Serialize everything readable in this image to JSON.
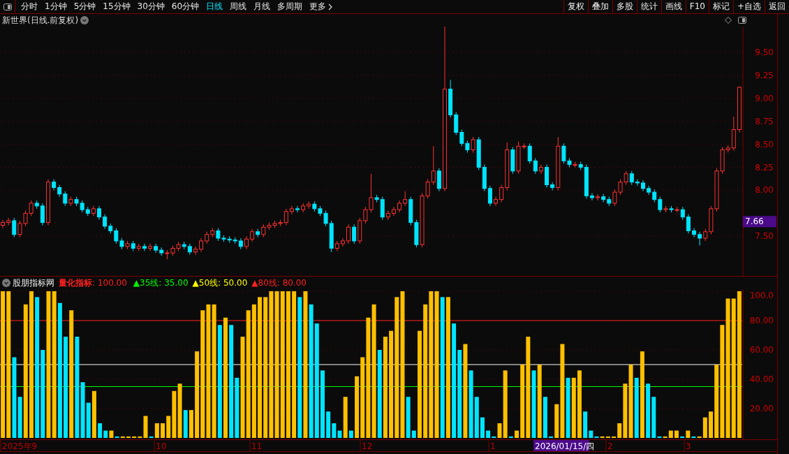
{
  "toolbar": {
    "tabs": [
      {
        "label": "分时",
        "selected": false
      },
      {
        "label": "1分钟",
        "selected": false
      },
      {
        "label": "5分钟",
        "selected": false
      },
      {
        "label": "15分钟",
        "selected": false
      },
      {
        "label": "30分钟",
        "selected": false
      },
      {
        "label": "60分钟",
        "selected": false
      },
      {
        "label": "日线",
        "selected": true
      },
      {
        "label": "周线",
        "selected": false
      },
      {
        "label": "月线",
        "selected": false
      },
      {
        "label": "多周期",
        "selected": false
      },
      {
        "label": "更多",
        "selected": false
      }
    ],
    "buttons": [
      "复权",
      "叠加",
      "多股",
      "统计",
      "画线",
      "F10",
      "标记",
      "+自选",
      "返回"
    ]
  },
  "price_panel": {
    "title": "新世界(日线.前复权)",
    "current_price": "7.66",
    "chart_data": {
      "type": "candlestick",
      "grid": true,
      "ylim": [
        7.07,
        9.78
      ],
      "yticks": [
        {
          "value": 7.5,
          "label": "7.50"
        },
        {
          "value": 8,
          "label": "8.00"
        },
        {
          "value": 8.25,
          "label": "8.25"
        },
        {
          "value": 8.5,
          "label": "8.50"
        },
        {
          "value": 8.75,
          "label": "8.75"
        },
        {
          "value": 9,
          "label": "9.00"
        },
        {
          "value": 9.25,
          "label": "9.25"
        },
        {
          "value": 9.5,
          "label": "9.50"
        }
      ],
      "ohlc": [
        [
          7.62,
          7.68,
          7.59,
          7.65
        ],
        [
          7.65,
          7.7,
          7.62,
          7.67
        ],
        [
          7.67,
          7.7,
          7.49,
          7.52
        ],
        [
          7.52,
          7.67,
          7.49,
          7.64
        ],
        [
          7.64,
          7.78,
          7.61,
          7.75
        ],
        [
          7.75,
          7.89,
          7.72,
          7.86
        ],
        [
          7.86,
          7.89,
          7.8,
          7.83
        ],
        [
          7.83,
          7.86,
          7.62,
          7.65
        ],
        [
          7.65,
          8.12,
          7.62,
          8.09
        ],
        [
          8.09,
          8.12,
          8.0,
          8.03
        ],
        [
          8.03,
          8.06,
          7.93,
          7.96
        ],
        [
          7.96,
          7.99,
          7.83,
          7.86
        ],
        [
          7.86,
          7.93,
          7.83,
          7.9
        ],
        [
          7.9,
          7.93,
          7.83,
          7.86
        ],
        [
          7.86,
          7.89,
          7.76,
          7.79
        ],
        [
          7.79,
          7.82,
          7.72,
          7.75
        ],
        [
          7.75,
          7.83,
          7.72,
          7.8
        ],
        [
          7.8,
          7.83,
          7.68,
          7.71
        ],
        [
          7.71,
          7.74,
          7.58,
          7.61
        ],
        [
          7.61,
          7.64,
          7.53,
          7.56
        ],
        [
          7.56,
          7.59,
          7.42,
          7.45
        ],
        [
          7.45,
          7.48,
          7.36,
          7.39
        ],
        [
          7.39,
          7.45,
          7.36,
          7.42
        ],
        [
          7.42,
          7.45,
          7.34,
          7.37
        ],
        [
          7.37,
          7.42,
          7.34,
          7.39
        ],
        [
          7.39,
          7.42,
          7.34,
          7.37
        ],
        [
          7.37,
          7.42,
          7.34,
          7.39
        ],
        [
          7.39,
          7.42,
          7.32,
          7.35
        ],
        [
          7.35,
          7.38,
          7.29,
          7.32
        ],
        [
          7.32,
          7.35,
          7.25,
          7.32
        ],
        [
          7.32,
          7.4,
          7.29,
          7.37
        ],
        [
          7.37,
          7.44,
          7.34,
          7.41
        ],
        [
          7.41,
          7.44,
          7.36,
          7.39
        ],
        [
          7.39,
          7.42,
          7.3,
          7.33
        ],
        [
          7.33,
          7.39,
          7.3,
          7.36
        ],
        [
          7.36,
          7.48,
          7.33,
          7.45
        ],
        [
          7.45,
          7.55,
          7.42,
          7.52
        ],
        [
          7.52,
          7.59,
          7.49,
          7.56
        ],
        [
          7.56,
          7.59,
          7.45,
          7.48
        ],
        [
          7.48,
          7.51,
          7.44,
          7.47
        ],
        [
          7.47,
          7.5,
          7.43,
          7.46
        ],
        [
          7.46,
          7.49,
          7.42,
          7.45
        ],
        [
          7.45,
          7.48,
          7.36,
          7.39
        ],
        [
          7.39,
          7.5,
          7.36,
          7.47
        ],
        [
          7.47,
          7.58,
          7.44,
          7.55
        ],
        [
          7.55,
          7.58,
          7.49,
          7.52
        ],
        [
          7.52,
          7.63,
          7.49,
          7.6
        ],
        [
          7.6,
          7.65,
          7.57,
          7.62
        ],
        [
          7.62,
          7.67,
          7.59,
          7.64
        ],
        [
          7.64,
          7.68,
          7.61,
          7.65
        ],
        [
          7.65,
          7.8,
          7.62,
          7.77
        ],
        [
          7.77,
          7.83,
          7.74,
          7.8
        ],
        [
          7.8,
          7.83,
          7.76,
          7.79
        ],
        [
          7.79,
          7.86,
          7.76,
          7.83
        ],
        [
          7.83,
          7.88,
          7.8,
          7.85
        ],
        [
          7.85,
          7.88,
          7.77,
          7.8
        ],
        [
          7.8,
          7.83,
          7.72,
          7.75
        ],
        [
          7.75,
          7.78,
          7.61,
          7.64
        ],
        [
          7.64,
          7.67,
          7.33,
          7.37
        ],
        [
          7.37,
          7.45,
          7.34,
          7.42
        ],
        [
          7.42,
          7.48,
          7.39,
          7.45
        ],
        [
          7.45,
          7.63,
          7.42,
          7.6
        ],
        [
          7.6,
          7.63,
          7.42,
          7.45
        ],
        [
          7.45,
          7.7,
          7.42,
          7.67
        ],
        [
          7.67,
          7.82,
          7.64,
          7.79
        ],
        [
          7.79,
          8.18,
          7.76,
          7.92
        ],
        [
          7.92,
          7.95,
          7.87,
          7.9
        ],
        [
          7.9,
          7.93,
          7.68,
          7.71
        ],
        [
          7.71,
          7.78,
          7.68,
          7.75
        ],
        [
          7.75,
          7.82,
          7.72,
          7.79
        ],
        [
          7.79,
          7.89,
          7.76,
          7.86
        ],
        [
          7.86,
          7.99,
          7.83,
          7.9
        ],
        [
          7.9,
          7.93,
          7.62,
          7.65
        ],
        [
          7.65,
          7.68,
          7.38,
          7.41
        ],
        [
          7.41,
          7.97,
          7.38,
          7.94
        ],
        [
          7.94,
          8.12,
          7.91,
          8.09
        ],
        [
          8.09,
          8.48,
          8.06,
          8.21
        ],
        [
          8.21,
          8.24,
          7.99,
          8.02
        ],
        [
          8.02,
          9.78,
          7.99,
          9.1
        ],
        [
          9.1,
          9.2,
          8.79,
          8.82
        ],
        [
          8.82,
          8.85,
          8.6,
          8.63
        ],
        [
          8.63,
          8.66,
          8.48,
          8.51
        ],
        [
          8.51,
          8.54,
          8.41,
          8.44
        ],
        [
          8.44,
          8.58,
          8.41,
          8.55
        ],
        [
          8.55,
          8.58,
          8.22,
          8.25
        ],
        [
          8.25,
          8.28,
          7.99,
          8.02
        ],
        [
          8.02,
          8.05,
          7.83,
          7.86
        ],
        [
          7.86,
          7.93,
          7.83,
          7.9
        ],
        [
          7.9,
          8.06,
          7.87,
          8.03
        ],
        [
          8.03,
          8.52,
          8.0,
          8.44
        ],
        [
          8.44,
          8.47,
          8.18,
          8.21
        ],
        [
          8.21,
          8.53,
          8.18,
          8.48
        ],
        [
          8.48,
          8.51,
          8.45,
          8.48
        ],
        [
          8.48,
          8.51,
          8.29,
          8.32
        ],
        [
          8.32,
          8.35,
          8.18,
          8.21
        ],
        [
          8.21,
          8.28,
          8.18,
          8.25
        ],
        [
          8.25,
          8.28,
          8.03,
          8.06
        ],
        [
          8.06,
          8.09,
          8.0,
          8.03
        ],
        [
          8.03,
          8.58,
          8.0,
          8.48
        ],
        [
          8.48,
          8.51,
          8.29,
          8.32
        ],
        [
          8.32,
          8.35,
          8.25,
          8.28
        ],
        [
          8.28,
          8.31,
          8.25,
          8.28
        ],
        [
          8.28,
          8.31,
          8.22,
          8.25
        ],
        [
          8.25,
          8.28,
          7.91,
          7.94
        ],
        [
          7.94,
          7.97,
          7.89,
          7.92
        ],
        [
          7.92,
          7.96,
          7.89,
          7.93
        ],
        [
          7.93,
          7.96,
          7.87,
          7.9
        ],
        [
          7.9,
          7.93,
          7.83,
          7.86
        ],
        [
          7.86,
          8.01,
          7.83,
          7.98
        ],
        [
          7.98,
          8.12,
          7.95,
          8.09
        ],
        [
          8.09,
          8.21,
          8.06,
          8.18
        ],
        [
          8.18,
          8.21,
          8.06,
          8.09
        ],
        [
          8.09,
          8.12,
          8.05,
          8.08
        ],
        [
          8.08,
          8.11,
          7.99,
          8.02
        ],
        [
          8.02,
          8.05,
          7.95,
          7.98
        ],
        [
          7.98,
          8.01,
          7.87,
          7.9
        ],
        [
          7.9,
          7.93,
          7.76,
          7.79
        ],
        [
          7.79,
          7.83,
          7.76,
          7.8
        ],
        [
          7.8,
          7.83,
          7.76,
          7.79
        ],
        [
          7.79,
          7.82,
          7.76,
          7.79
        ],
        [
          7.79,
          7.82,
          7.68,
          7.71
        ],
        [
          7.71,
          7.74,
          7.53,
          7.56
        ],
        [
          7.56,
          7.59,
          7.49,
          7.52
        ],
        [
          7.52,
          7.55,
          7.4,
          7.48
        ],
        [
          7.48,
          7.58,
          7.45,
          7.55
        ],
        [
          7.55,
          7.83,
          7.52,
          7.8
        ],
        [
          7.8,
          8.24,
          7.77,
          8.21
        ],
        [
          8.21,
          8.47,
          8.18,
          8.44
        ],
        [
          8.44,
          8.49,
          8.41,
          8.46
        ],
        [
          8.46,
          8.8,
          8.43,
          8.66
        ],
        [
          8.66,
          9.13,
          8.63,
          9.12
        ]
      ]
    }
  },
  "indicator_panel": {
    "source": "股朋指标网",
    "reading": ": 100.00",
    "chart_data": {
      "type": "bar",
      "grid": true,
      "ylim": [
        0,
        101.4
      ],
      "yticks": [
        {
          "value": 20,
          "label": "20.00"
        },
        {
          "value": 40,
          "label": "40.00"
        },
        {
          "value": 60,
          "label": "60.00"
        },
        {
          "value": 80,
          "label": "80.00"
        },
        {
          "value": 100,
          "label": "100.0"
        }
      ],
      "series": [
        {
          "name": "量化指标",
          "color": "#ffc000",
          "values": [
            100,
            100,
            null,
            null,
            91,
            100,
            null,
            null,
            100,
            100,
            null,
            null,
            87,
            null,
            null,
            null,
            32,
            null,
            null,
            5,
            null,
            1,
            1,
            1,
            1,
            15,
            null,
            10,
            10,
            15,
            32,
            37,
            null,
            19,
            59,
            87,
            91,
            91,
            null,
            82,
            null,
            null,
            69,
            87,
            91,
            96,
            96,
            100,
            100,
            100,
            100,
            100,
            null,
            100,
            null,
            null,
            null,
            null,
            null,
            null,
            28,
            null,
            42,
            55,
            82,
            91,
            null,
            69,
            73,
            96,
            100,
            null,
            null,
            73,
            91,
            100,
            100,
            null,
            96,
            null,
            null,
            64,
            null,
            null,
            null,
            null,
            null,
            10,
            46,
            null,
            5,
            50,
            69,
            null,
            50,
            null,
            null,
            23,
            64,
            null,
            41,
            46,
            null,
            null,
            null,
            1,
            1,
            1,
            10,
            37,
            50,
            null,
            59,
            null,
            null,
            null,
            1,
            5,
            5,
            null,
            5,
            null,
            1,
            14,
            18,
            50,
            77,
            95,
            95,
            100
          ]
        },
        {
          "color": "#00e5ff",
          "values": [
            null,
            null,
            55,
            28,
            null,
            null,
            96,
            60,
            null,
            null,
            92,
            69,
            null,
            69,
            38,
            24,
            null,
            10,
            5,
            null,
            1,
            null,
            null,
            null,
            null,
            null,
            1,
            null,
            null,
            null,
            null,
            null,
            19,
            null,
            null,
            null,
            null,
            null,
            77,
            null,
            77,
            41,
            null,
            null,
            null,
            null,
            null,
            null,
            null,
            null,
            null,
            null,
            96,
            null,
            91,
            78,
            46,
            18,
            10,
            5,
            null,
            5,
            null,
            null,
            null,
            null,
            60,
            null,
            null,
            null,
            null,
            28,
            5,
            null,
            null,
            null,
            null,
            96,
            null,
            78,
            60,
            null,
            46,
            28,
            14,
            5,
            1,
            null,
            null,
            1,
            null,
            null,
            null,
            46,
            null,
            28,
            1,
            null,
            null,
            41,
            null,
            null,
            18,
            5,
            1,
            null,
            null,
            null,
            null,
            null,
            null,
            41,
            null,
            37,
            28,
            1,
            null,
            null,
            null,
            1,
            null,
            1,
            null,
            null,
            null,
            null,
            null,
            null,
            null,
            null
          ]
        }
      ],
      "ref_lines": [
        {
          "axis": "y",
          "value": 35,
          "label": "▲35线: 35.00",
          "color": "#00ff00"
        },
        {
          "axis": "y",
          "value": 50,
          "label": "▲50线: 50.00",
          "color": "#ffffff"
        },
        {
          "axis": "y",
          "value": 80,
          "label": "▲80线: 80.00",
          "color": "#ff2020"
        }
      ]
    },
    "date_axis": [
      {
        "label": "2025年9"
      },
      {
        "label": "10"
      },
      {
        "label": "11"
      },
      {
        "label": "12"
      },
      {
        "label": "1"
      },
      {
        "label": "2026/01/15/四",
        "kind": "cursor"
      },
      {
        "label": "2"
      },
      {
        "label": "3"
      }
    ]
  }
}
